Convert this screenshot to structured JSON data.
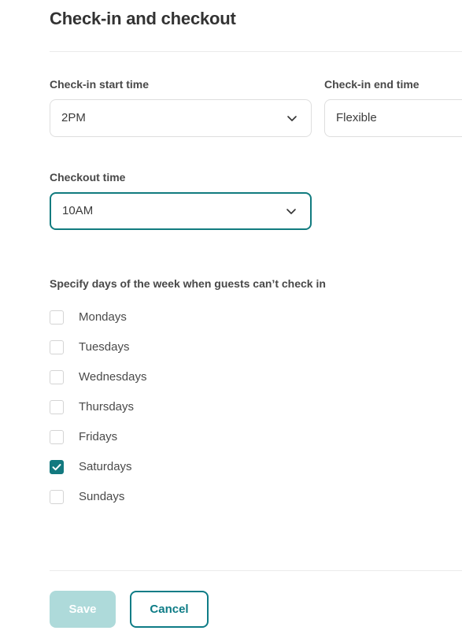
{
  "page": {
    "title": "Check-in and checkout"
  },
  "fields": {
    "checkin_start": {
      "label": "Check-in start time",
      "value": "2PM",
      "icon": "chevron-down-icon"
    },
    "checkin_end": {
      "label": "Check-in end time",
      "value": "Flexible",
      "icon": "chevron-down-icon"
    },
    "checkout": {
      "label": "Checkout time",
      "value": "10AM",
      "icon": "chevron-down-icon",
      "focused": true
    }
  },
  "blocked_days": {
    "heading": "Specify days of the week when guests can’t check in",
    "items": [
      {
        "label": "Mondays",
        "checked": false
      },
      {
        "label": "Tuesdays",
        "checked": false
      },
      {
        "label": "Wednesdays",
        "checked": false
      },
      {
        "label": "Thursdays",
        "checked": false
      },
      {
        "label": "Fridays",
        "checked": false
      },
      {
        "label": "Saturdays",
        "checked": true
      },
      {
        "label": "Sundays",
        "checked": false
      }
    ]
  },
  "footer": {
    "save_label": "Save",
    "cancel_label": "Cancel"
  },
  "colors": {
    "accent_teal": "#0e7c86",
    "checkbox_teal": "#13797f",
    "focus_border": "#117b7f",
    "save_disabled": "#aedada",
    "divider": "#ebebeb",
    "field_border": "#dedede"
  }
}
